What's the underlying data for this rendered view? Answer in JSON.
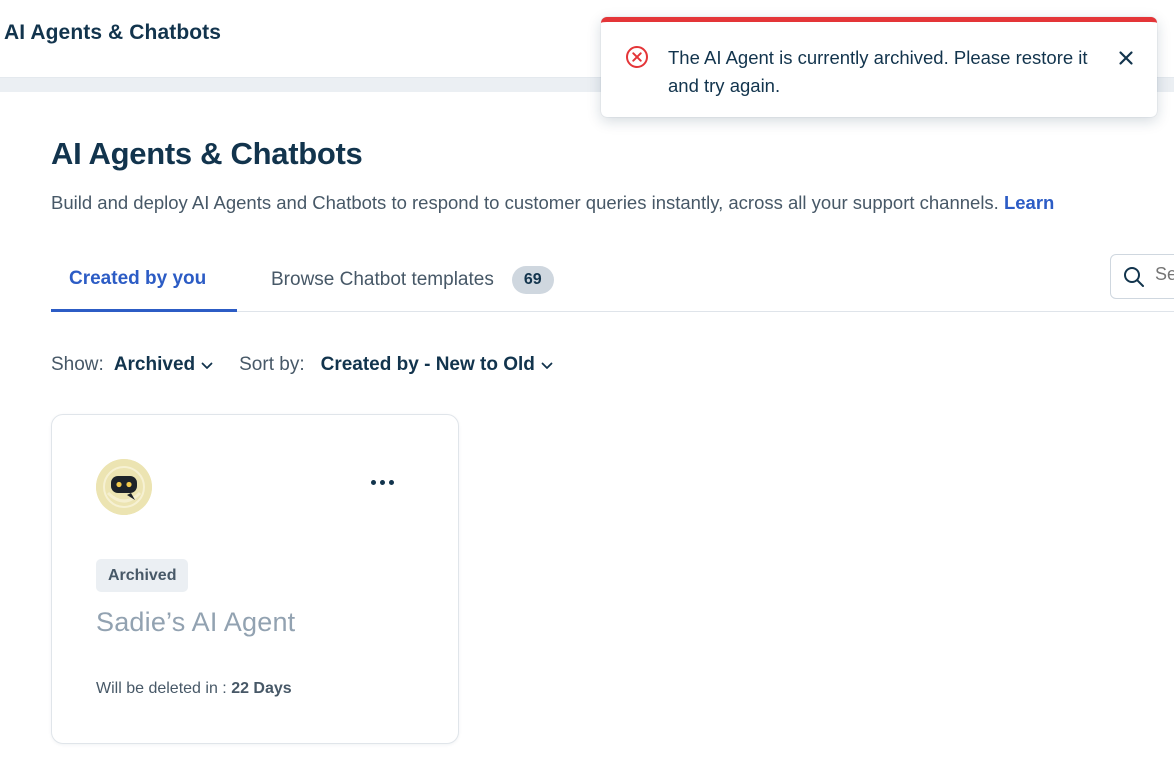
{
  "header": {
    "title": "AI Agents & Chatbots"
  },
  "page": {
    "title": "AI Agents & Chatbots",
    "description": "Build and deploy AI Agents and Chatbots to respond to customer queries instantly, across all your support channels.",
    "learn_more_label": "Learn"
  },
  "tabs": {
    "created_by_you": "Created by you",
    "browse_templates": "Browse Chatbot templates",
    "templates_count": "69"
  },
  "search": {
    "placeholder": "Se"
  },
  "filters": {
    "show_label": "Show:",
    "show_value": "Archived",
    "sort_label": "Sort by:",
    "sort_value": "Created by - New to Old"
  },
  "card": {
    "status_badge": "Archived",
    "name": "Sadie’s AI Agent",
    "delete_label": "Will be deleted in :",
    "delete_value": "22 Days"
  },
  "toast": {
    "message": "The AI Agent is currently archived. Please restore it and try again.",
    "accent_color": "#e43538"
  },
  "colors": {
    "primary": "#2c5cc5",
    "text": "#12344d",
    "muted": "#92a2b1"
  },
  "icons": {
    "toast_icon": "error-circle-icon",
    "close": "close-icon",
    "search": "search-icon",
    "dropdown": "chevron-down-icon",
    "menu": "more-horizontal-icon",
    "avatar": "robot-avatar-icon"
  }
}
